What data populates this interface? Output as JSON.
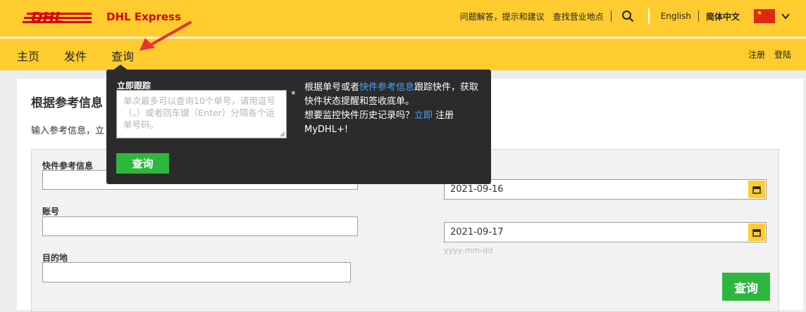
{
  "header": {
    "brand_text": "DHL Express",
    "logo_text": "DHL",
    "links": [
      "问题解答，提示和建议",
      "查找营业地点"
    ],
    "lang_en": "English",
    "lang_zh": "简体中文",
    "icons": [
      "search-icon",
      "china-flag-icon",
      "chevron-down-icon"
    ]
  },
  "nav": {
    "items": [
      "主页",
      "发件",
      "查询"
    ],
    "register": "注册",
    "login": "登陆"
  },
  "main": {
    "title": "根据参考信息",
    "subtitle": "输入参考信息，立",
    "form": {
      "ref_label": "快件参考信息",
      "account_label": "账号",
      "dest_label": "目的地",
      "date_from": "2021-09-16",
      "date_to": "2021-09-17",
      "date_hint": "yyyy-mm-dd",
      "submit": "查询"
    }
  },
  "popover": {
    "title": "立即跟踪",
    "placeholder": "单次最多可以查询10个单号，请用逗号（，）或者回车键（Enter）分隔各个运单号码。",
    "required_mark": "*",
    "submit": "查询",
    "info_1": "根据单号或者",
    "info_link": "快件参考信息",
    "info_2": "跟踪快件，获取快件状态提醒和签收底单。",
    "info_3": "想要监控快件历史记录吗？",
    "info_link2": "立即",
    "info_4": " 注册 MyDHL+!"
  },
  "colors": {
    "brand_yellow": "#ffcc2f",
    "brand_red": "#d40511",
    "button_green": "#2db83d",
    "popover_bg": "#2b2b2b",
    "link_blue": "#4aa3ff"
  }
}
